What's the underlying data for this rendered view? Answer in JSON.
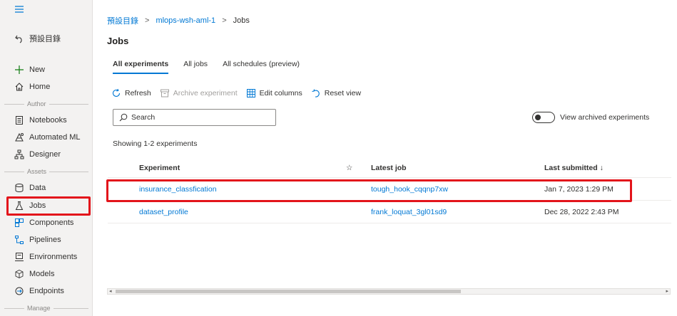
{
  "sidebar": {
    "back_label": "預設目錄",
    "new_label": "New",
    "home_label": "Home",
    "section_author": "Author",
    "section_assets": "Assets",
    "section_manage": "Manage",
    "items": [
      {
        "label": "Notebooks"
      },
      {
        "label": "Automated ML"
      },
      {
        "label": "Designer"
      },
      {
        "label": "Data"
      },
      {
        "label": "Jobs"
      },
      {
        "label": "Components"
      },
      {
        "label": "Pipelines"
      },
      {
        "label": "Environments"
      },
      {
        "label": "Models"
      },
      {
        "label": "Endpoints"
      }
    ]
  },
  "breadcrumb": {
    "root": "預設目錄",
    "workspace": "mlops-wsh-aml-1",
    "current": "Jobs"
  },
  "page": {
    "title": "Jobs"
  },
  "tabs": [
    {
      "label": "All experiments",
      "active": true
    },
    {
      "label": "All jobs"
    },
    {
      "label": "All schedules (preview)"
    }
  ],
  "toolbar": {
    "refresh": "Refresh",
    "archive": "Archive experiment",
    "edit_columns": "Edit columns",
    "reset_view": "Reset view"
  },
  "search": {
    "placeholder": "Search"
  },
  "toggle": {
    "label": "View archived experiments"
  },
  "showing": "Showing 1-2 experiments",
  "grid": {
    "columns": {
      "experiment": "Experiment",
      "star": "☆",
      "latest_job": "Latest job",
      "last_submitted": "Last submitted ↓"
    },
    "rows": [
      {
        "experiment": "insurance_classfication",
        "latest_job": "tough_hook_cqqnp7xw",
        "last_submitted": "Jan 7, 2023 1:29 PM"
      },
      {
        "experiment": "dataset_profile",
        "latest_job": "frank_loquat_3gl01sd9",
        "last_submitted": "Dec 28, 2022 2:43 PM"
      }
    ]
  },
  "colors": {
    "accent": "#0078d4",
    "highlight": "#e3141b",
    "new_icon": "#107c10"
  }
}
